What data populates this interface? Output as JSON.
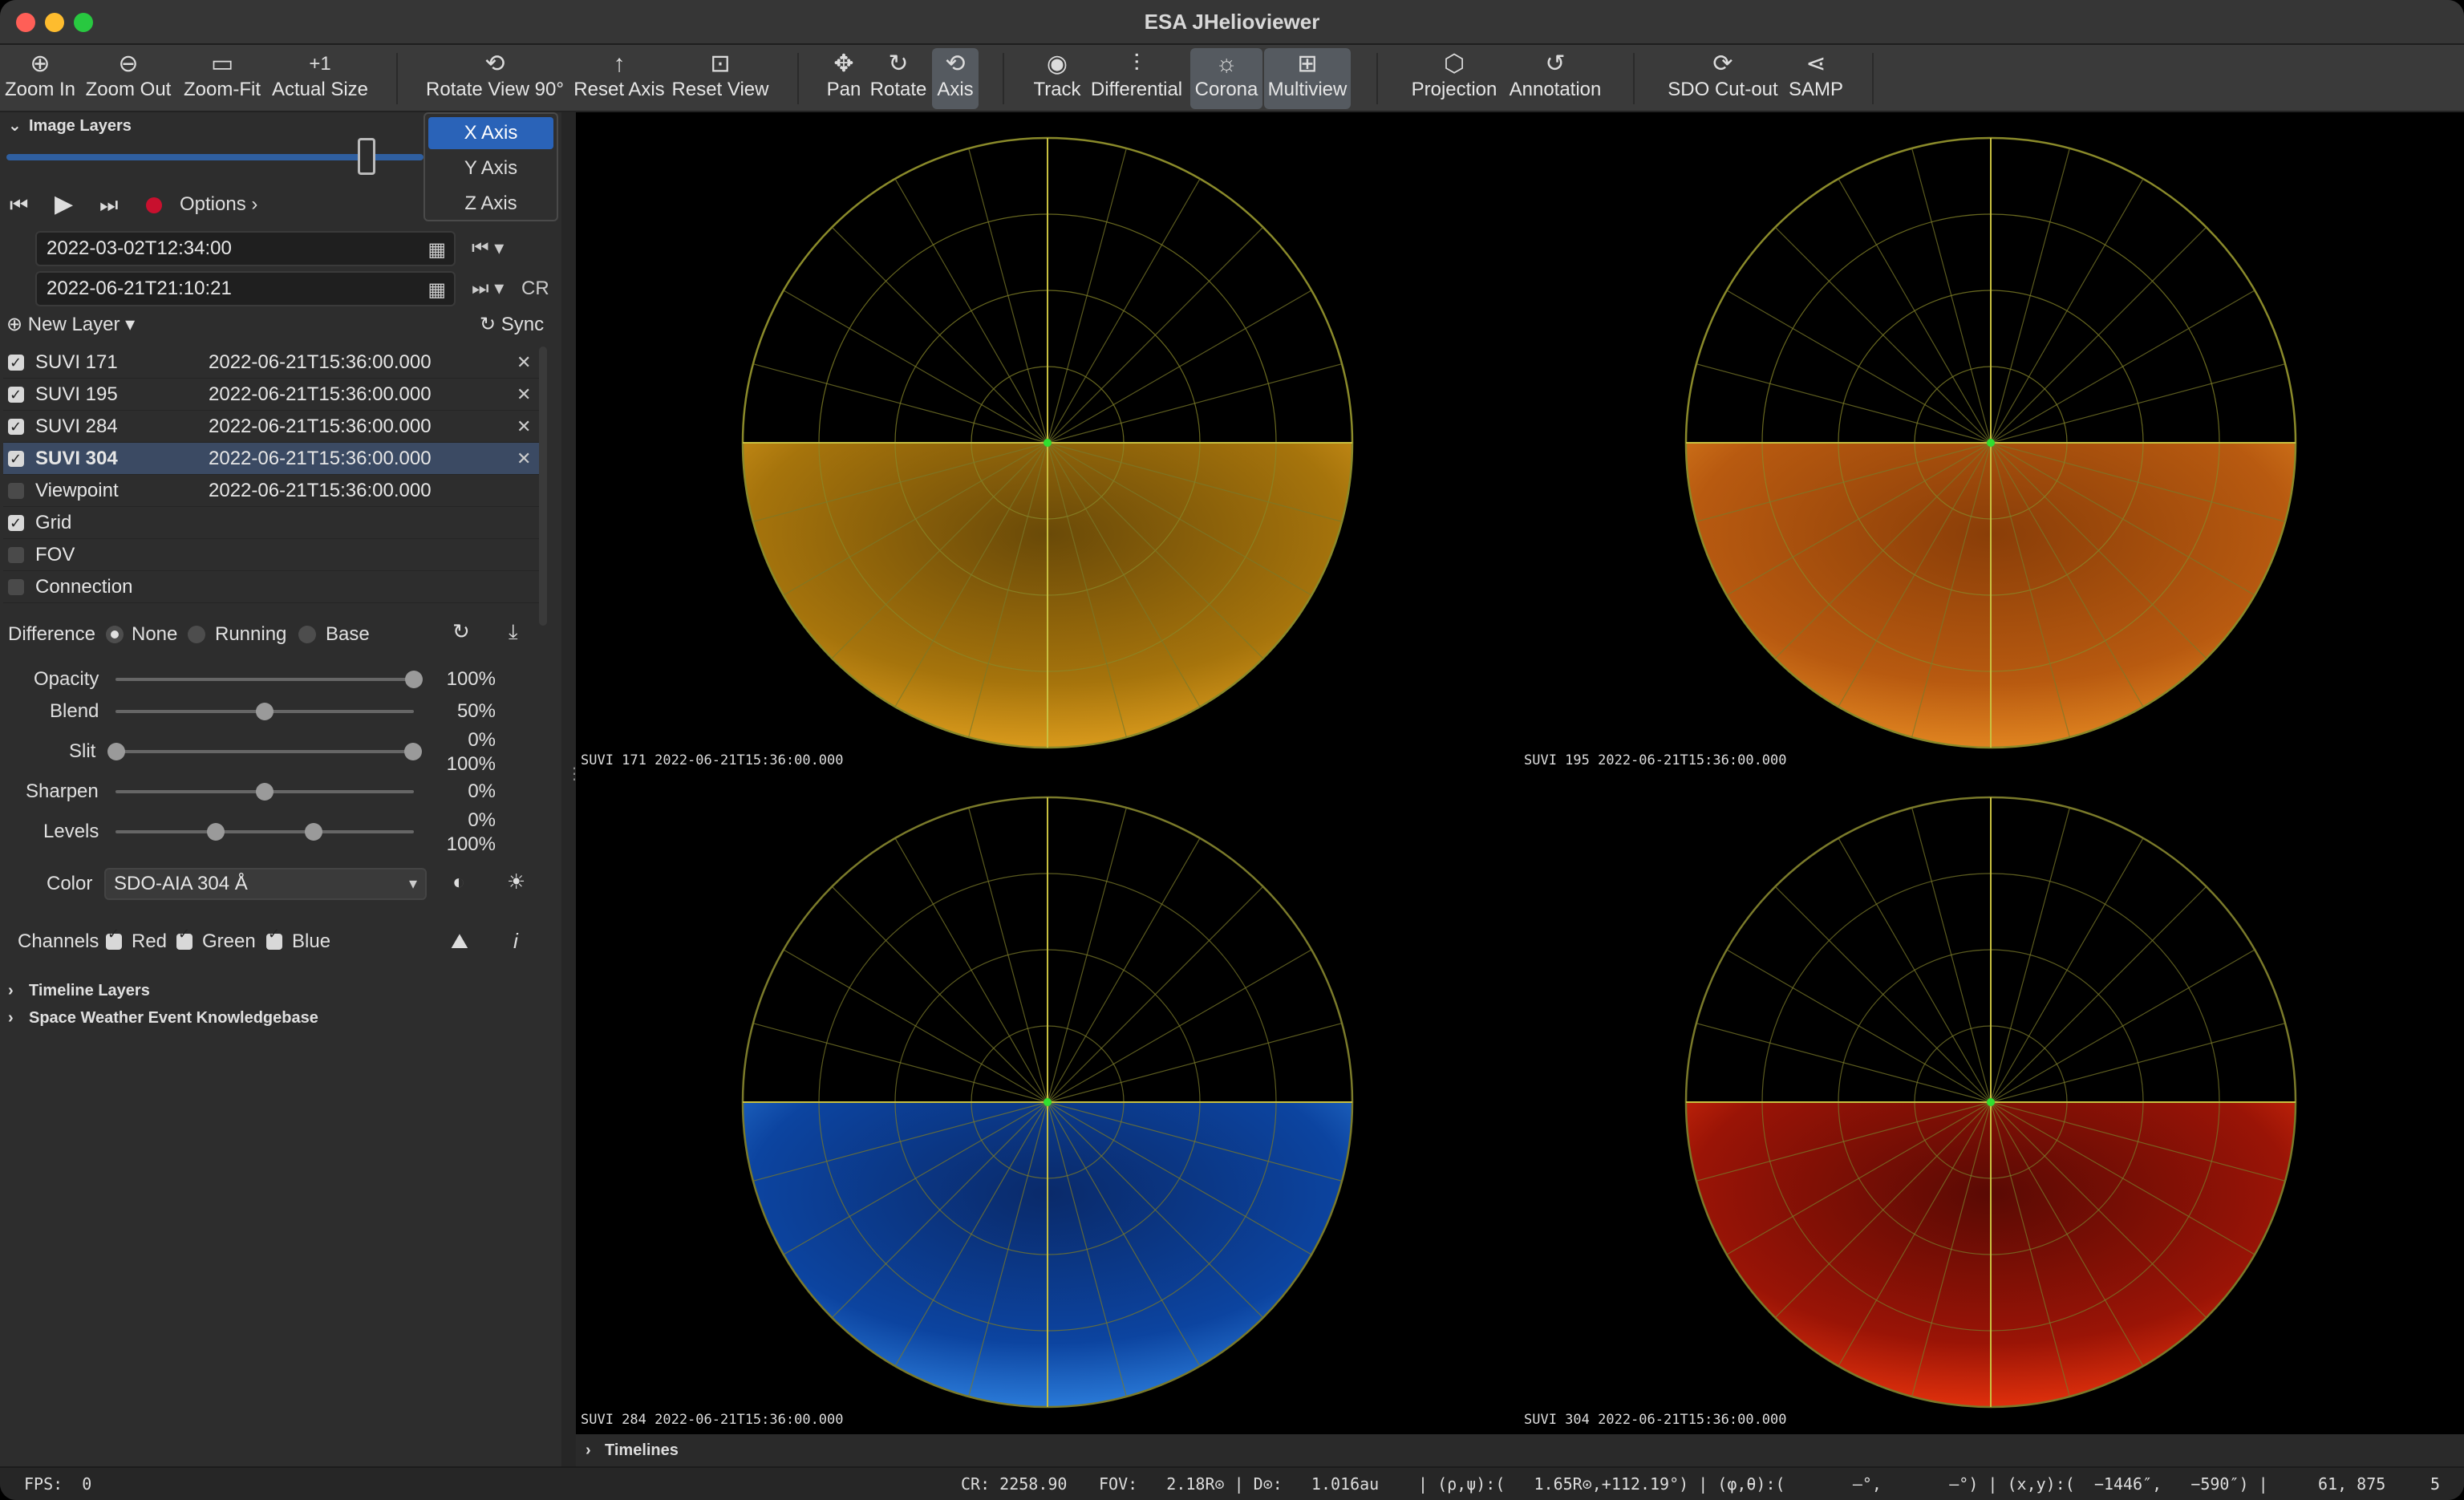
{
  "window": {
    "title": "ESA JHelioviewer"
  },
  "toolbar": {
    "zoom_in": "Zoom In",
    "zoom_out": "Zoom Out",
    "zoom_fit": "Zoom-Fit",
    "actual_size": "Actual Size",
    "actual_size_icon_text": "+1",
    "rotate_view": "Rotate View 90°",
    "reset_axis": "Reset Axis",
    "reset_view": "Reset View",
    "pan": "Pan",
    "rotate": "Rotate",
    "axis": "Axis",
    "track": "Track",
    "differential": "Differential",
    "corona": "Corona",
    "multiview": "Multiview",
    "projection": "Projection",
    "annotation": "Annotation",
    "sdo_cutout": "SDO Cut-out",
    "samp": "SAMP"
  },
  "axis_menu": {
    "items": [
      "X Axis",
      "Y Axis",
      "Z Axis"
    ],
    "selected": "X Axis"
  },
  "image_layers": {
    "header": "Image Layers",
    "options": "Options",
    "start_date": "2022-03-02T12:34:00",
    "end_date": "2022-06-21T21:10:21",
    "cr": "CR",
    "new_layer": "New Layer",
    "sync": "Sync",
    "layers": [
      {
        "name": "SUVI 171",
        "time": "2022-06-21T15:36:00.000",
        "checked": true,
        "removable": true
      },
      {
        "name": "SUVI 195",
        "time": "2022-06-21T15:36:00.000",
        "checked": true,
        "removable": true
      },
      {
        "name": "SUVI 284",
        "time": "2022-06-21T15:36:00.000",
        "checked": true,
        "removable": true
      },
      {
        "name": "SUVI 304",
        "time": "2022-06-21T15:36:00.000",
        "checked": true,
        "removable": true,
        "selected": true
      },
      {
        "name": "Viewpoint",
        "time": "2022-06-21T15:36:00.000",
        "checked": false
      },
      {
        "name": "Grid",
        "time": "",
        "checked": true
      },
      {
        "name": "FOV",
        "time": "",
        "checked": false
      },
      {
        "name": "Connection",
        "time": "",
        "checked": false
      }
    ]
  },
  "adjustments": {
    "difference_label": "Difference",
    "diff_options": [
      "None",
      "Running",
      "Base"
    ],
    "diff_selected": "None",
    "opacity_label": "Opacity",
    "opacity_value": "100%",
    "opacity_level": 1.0,
    "blend_label": "Blend",
    "blend_value": "50%",
    "blend_level": 0.5,
    "slit_label": "Slit",
    "slit_low": "0%",
    "slit_high": "100%",
    "sharpen_label": "Sharpen",
    "sharpen_value": "0%",
    "sharpen_level": 0.5,
    "levels_label": "Levels",
    "levels_low": "0%",
    "levels_high": "100%",
    "color_label": "Color",
    "color_value": "SDO-AIA 304 Å",
    "channels_label": "Channels",
    "red": "Red",
    "green": "Green",
    "blue": "Blue"
  },
  "sections": {
    "timeline_layers": "Timeline Layers",
    "swek": "Space Weather Event Knowledgebase",
    "timelines": "Timelines"
  },
  "viewer": {
    "quadrants": [
      {
        "label": "SUVI 171 2022-06-21T15:36:00.000",
        "color": "#c88a10"
      },
      {
        "label": "SUVI 195 2022-06-21T15:36:00.000",
        "color": "#c8660c"
      },
      {
        "label": "SUVI 284 2022-06-21T15:36:00.000",
        "color": "#1050b0"
      },
      {
        "label": "SUVI 304 2022-06-21T15:36:00.000",
        "color": "#b81808"
      }
    ]
  },
  "status": {
    "fps": "FPS:  0",
    "cr": "CR: 2258.90",
    "fov": "FOV:   2.18R⊙ | D⊙:   1.016au",
    "rho_psi": "| (ρ,ψ):(   1.65R⊙,+112.19°) | (φ,θ):(       ‒°,       ‒°) | (x,y):(  −1446″,   −590″) |",
    "pixel": "61, 875",
    "count": "5"
  }
}
